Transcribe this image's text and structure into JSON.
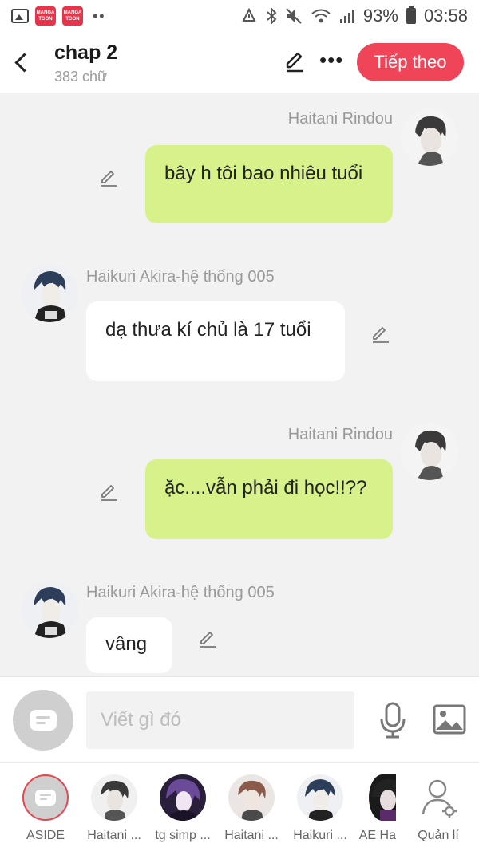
{
  "status_bar": {
    "badge1": "MANGA TOON",
    "badge2": "MANGA TOON",
    "dots": "••",
    "battery": "93%",
    "time": "03:58"
  },
  "header": {
    "title": "chap 2",
    "subtitle": "383 chữ",
    "next_label": "Tiếp theo"
  },
  "messages": [
    {
      "name": "Haitani Rindou",
      "text": "bây h tôi bao nhiêu tuổi",
      "side": "right"
    },
    {
      "name": "Haikuri Akira-hệ thống 005",
      "text": "dạ thưa kí chủ là 17 tuổi",
      "side": "left"
    },
    {
      "name": "Haitani Rindou",
      "text": "ặc....vẫn phải đi học!!??",
      "side": "right"
    },
    {
      "name": "Haikuri Akira-hệ thống 005",
      "text": "vâng",
      "side": "left"
    }
  ],
  "input": {
    "placeholder": "Viết gì đó"
  },
  "characters": [
    {
      "label": "ASIDE"
    },
    {
      "label": "Haitani ..."
    },
    {
      "label": "tg simp ..."
    },
    {
      "label": "Haitani ..."
    },
    {
      "label": "Haikuri ..."
    },
    {
      "label": "AE Ha"
    },
    {
      "label": "Quản lí"
    }
  ],
  "colors": {
    "accent": "#f04458",
    "green_bubble": "#d7f28a",
    "background": "#f2f2f2"
  }
}
